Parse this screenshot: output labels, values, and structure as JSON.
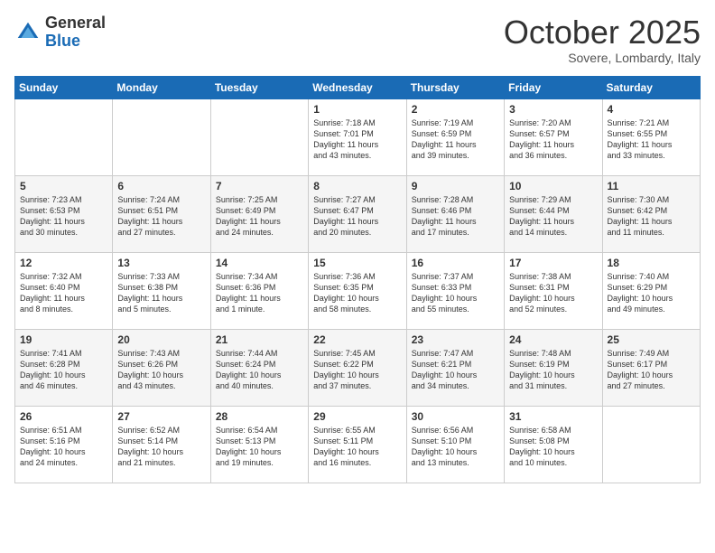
{
  "header": {
    "logo_general": "General",
    "logo_blue": "Blue",
    "month": "October 2025",
    "location": "Sovere, Lombardy, Italy"
  },
  "days_of_week": [
    "Sunday",
    "Monday",
    "Tuesday",
    "Wednesday",
    "Thursday",
    "Friday",
    "Saturday"
  ],
  "weeks": [
    [
      {
        "num": "",
        "info": ""
      },
      {
        "num": "",
        "info": ""
      },
      {
        "num": "",
        "info": ""
      },
      {
        "num": "1",
        "info": "Sunrise: 7:18 AM\nSunset: 7:01 PM\nDaylight: 11 hours\nand 43 minutes."
      },
      {
        "num": "2",
        "info": "Sunrise: 7:19 AM\nSunset: 6:59 PM\nDaylight: 11 hours\nand 39 minutes."
      },
      {
        "num": "3",
        "info": "Sunrise: 7:20 AM\nSunset: 6:57 PM\nDaylight: 11 hours\nand 36 minutes."
      },
      {
        "num": "4",
        "info": "Sunrise: 7:21 AM\nSunset: 6:55 PM\nDaylight: 11 hours\nand 33 minutes."
      }
    ],
    [
      {
        "num": "5",
        "info": "Sunrise: 7:23 AM\nSunset: 6:53 PM\nDaylight: 11 hours\nand 30 minutes."
      },
      {
        "num": "6",
        "info": "Sunrise: 7:24 AM\nSunset: 6:51 PM\nDaylight: 11 hours\nand 27 minutes."
      },
      {
        "num": "7",
        "info": "Sunrise: 7:25 AM\nSunset: 6:49 PM\nDaylight: 11 hours\nand 24 minutes."
      },
      {
        "num": "8",
        "info": "Sunrise: 7:27 AM\nSunset: 6:47 PM\nDaylight: 11 hours\nand 20 minutes."
      },
      {
        "num": "9",
        "info": "Sunrise: 7:28 AM\nSunset: 6:46 PM\nDaylight: 11 hours\nand 17 minutes."
      },
      {
        "num": "10",
        "info": "Sunrise: 7:29 AM\nSunset: 6:44 PM\nDaylight: 11 hours\nand 14 minutes."
      },
      {
        "num": "11",
        "info": "Sunrise: 7:30 AM\nSunset: 6:42 PM\nDaylight: 11 hours\nand 11 minutes."
      }
    ],
    [
      {
        "num": "12",
        "info": "Sunrise: 7:32 AM\nSunset: 6:40 PM\nDaylight: 11 hours\nand 8 minutes."
      },
      {
        "num": "13",
        "info": "Sunrise: 7:33 AM\nSunset: 6:38 PM\nDaylight: 11 hours\nand 5 minutes."
      },
      {
        "num": "14",
        "info": "Sunrise: 7:34 AM\nSunset: 6:36 PM\nDaylight: 11 hours\nand 1 minute."
      },
      {
        "num": "15",
        "info": "Sunrise: 7:36 AM\nSunset: 6:35 PM\nDaylight: 10 hours\nand 58 minutes."
      },
      {
        "num": "16",
        "info": "Sunrise: 7:37 AM\nSunset: 6:33 PM\nDaylight: 10 hours\nand 55 minutes."
      },
      {
        "num": "17",
        "info": "Sunrise: 7:38 AM\nSunset: 6:31 PM\nDaylight: 10 hours\nand 52 minutes."
      },
      {
        "num": "18",
        "info": "Sunrise: 7:40 AM\nSunset: 6:29 PM\nDaylight: 10 hours\nand 49 minutes."
      }
    ],
    [
      {
        "num": "19",
        "info": "Sunrise: 7:41 AM\nSunset: 6:28 PM\nDaylight: 10 hours\nand 46 minutes."
      },
      {
        "num": "20",
        "info": "Sunrise: 7:43 AM\nSunset: 6:26 PM\nDaylight: 10 hours\nand 43 minutes."
      },
      {
        "num": "21",
        "info": "Sunrise: 7:44 AM\nSunset: 6:24 PM\nDaylight: 10 hours\nand 40 minutes."
      },
      {
        "num": "22",
        "info": "Sunrise: 7:45 AM\nSunset: 6:22 PM\nDaylight: 10 hours\nand 37 minutes."
      },
      {
        "num": "23",
        "info": "Sunrise: 7:47 AM\nSunset: 6:21 PM\nDaylight: 10 hours\nand 34 minutes."
      },
      {
        "num": "24",
        "info": "Sunrise: 7:48 AM\nSunset: 6:19 PM\nDaylight: 10 hours\nand 31 minutes."
      },
      {
        "num": "25",
        "info": "Sunrise: 7:49 AM\nSunset: 6:17 PM\nDaylight: 10 hours\nand 27 minutes."
      }
    ],
    [
      {
        "num": "26",
        "info": "Sunrise: 6:51 AM\nSunset: 5:16 PM\nDaylight: 10 hours\nand 24 minutes."
      },
      {
        "num": "27",
        "info": "Sunrise: 6:52 AM\nSunset: 5:14 PM\nDaylight: 10 hours\nand 21 minutes."
      },
      {
        "num": "28",
        "info": "Sunrise: 6:54 AM\nSunset: 5:13 PM\nDaylight: 10 hours\nand 19 minutes."
      },
      {
        "num": "29",
        "info": "Sunrise: 6:55 AM\nSunset: 5:11 PM\nDaylight: 10 hours\nand 16 minutes."
      },
      {
        "num": "30",
        "info": "Sunrise: 6:56 AM\nSunset: 5:10 PM\nDaylight: 10 hours\nand 13 minutes."
      },
      {
        "num": "31",
        "info": "Sunrise: 6:58 AM\nSunset: 5:08 PM\nDaylight: 10 hours\nand 10 minutes."
      },
      {
        "num": "",
        "info": ""
      }
    ]
  ]
}
